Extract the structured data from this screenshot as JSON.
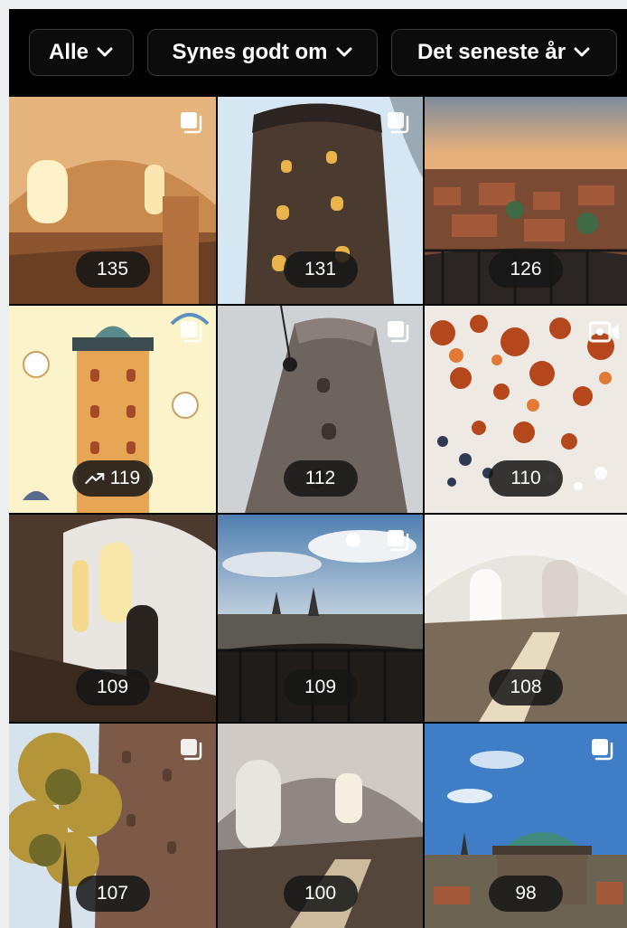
{
  "filters": [
    {
      "label": "Alle",
      "icon": "chevron-down-icon"
    },
    {
      "label": "Synes godt om",
      "icon": "chevron-down-icon"
    },
    {
      "label": "Det seneste år",
      "icon": "chevron-down-icon"
    }
  ],
  "posts": [
    {
      "count": "135",
      "type": "carousel",
      "scene": "arch-interior-warm"
    },
    {
      "count": "131",
      "type": "carousel",
      "scene": "tower-brick-sky"
    },
    {
      "count": "126",
      "type": "none",
      "scene": "city-rooftops-sunset"
    },
    {
      "count": "119",
      "type": "carousel",
      "scene": "illustrated-tower-poster",
      "trending": true
    },
    {
      "count": "112",
      "type": "carousel",
      "scene": "tower-fog"
    },
    {
      "count": "110",
      "type": "video",
      "scene": "glass-orbs-installation"
    },
    {
      "count": "109",
      "type": "none",
      "scene": "window-interior-white"
    },
    {
      "count": "109",
      "type": "carousel",
      "scene": "city-skyline-railing"
    },
    {
      "count": "108",
      "type": "none",
      "scene": "white-ramp-interior"
    },
    {
      "count": "107",
      "type": "carousel",
      "scene": "tree-and-tower"
    },
    {
      "count": "100",
      "type": "none",
      "scene": "arched-window-interior"
    },
    {
      "count": "98",
      "type": "carousel",
      "scene": "observatory-dome-blue-sky"
    }
  ],
  "colors": {
    "background": "#000000",
    "chip_border": "#3a3a3c",
    "badge_bg": "#161616",
    "text": "#ffffff"
  }
}
